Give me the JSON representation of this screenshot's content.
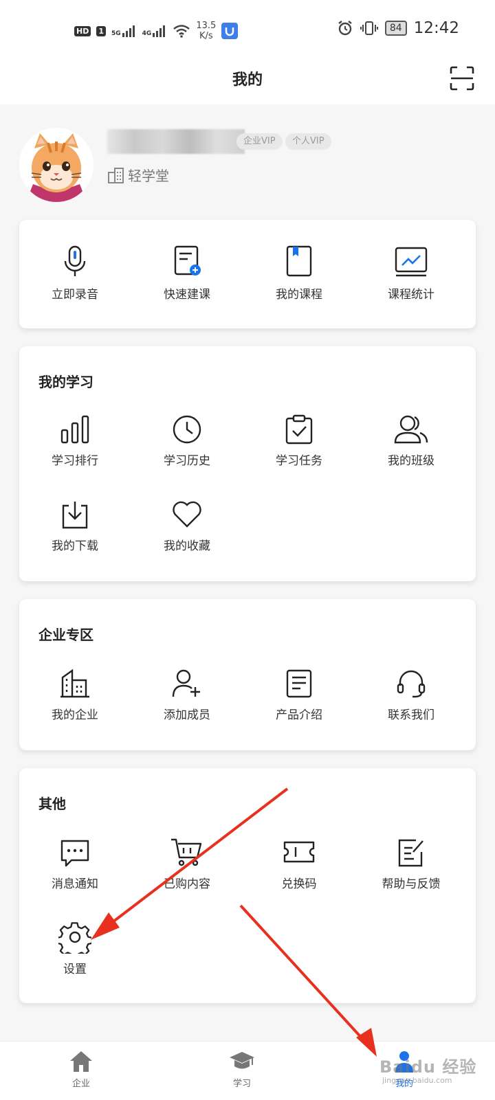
{
  "status_bar": {
    "hd": "HD",
    "sim": "1",
    "net1": "5G",
    "net2": "4G",
    "speed_value": "13.5",
    "speed_unit": "K/s",
    "battery": "84",
    "time": "12:42"
  },
  "header": {
    "title": "我的",
    "scan_icon": "scan-icon"
  },
  "profile": {
    "vip_enterprise": "企业VIP",
    "vip_personal": "个人VIP",
    "company": "轻学堂"
  },
  "quick_actions": [
    {
      "label": "立即录音",
      "icon": "microphone-icon"
    },
    {
      "label": "快速建课",
      "icon": "create-course-icon"
    },
    {
      "label": "我的课程",
      "icon": "book-icon"
    },
    {
      "label": "课程统计",
      "icon": "chart-icon"
    }
  ],
  "my_learning": {
    "title": "我的学习",
    "items": [
      {
        "label": "学习排行",
        "icon": "bar-chart-icon"
      },
      {
        "label": "学习历史",
        "icon": "clock-icon"
      },
      {
        "label": "学习任务",
        "icon": "clipboard-check-icon"
      },
      {
        "label": "我的班级",
        "icon": "users-icon"
      },
      {
        "label": "我的下载",
        "icon": "download-icon"
      },
      {
        "label": "我的收藏",
        "icon": "heart-icon"
      }
    ]
  },
  "enterprise": {
    "title": "企业专区",
    "items": [
      {
        "label": "我的企业",
        "icon": "building-icon"
      },
      {
        "label": "添加成员",
        "icon": "add-user-icon"
      },
      {
        "label": "产品介绍",
        "icon": "document-icon"
      },
      {
        "label": "联系我们",
        "icon": "headset-icon"
      }
    ]
  },
  "other": {
    "title": "其他",
    "items": [
      {
        "label": "消息通知",
        "icon": "message-icon"
      },
      {
        "label": "已购内容",
        "icon": "cart-icon"
      },
      {
        "label": "兑换码",
        "icon": "ticket-icon"
      },
      {
        "label": "帮助与反馈",
        "icon": "feedback-icon"
      },
      {
        "label": "设置",
        "icon": "gear-icon"
      }
    ]
  },
  "tabs": [
    {
      "label": "企业",
      "icon": "home-icon"
    },
    {
      "label": "学习",
      "icon": "graduation-cap-icon"
    },
    {
      "label": "我的",
      "icon": "person-icon",
      "active": true
    }
  ],
  "watermark": {
    "brand": "Baidu 经验",
    "url": "jingyan.baidu.com"
  },
  "colors": {
    "accent": "#1a73e8",
    "arrow": "#e8301f"
  }
}
